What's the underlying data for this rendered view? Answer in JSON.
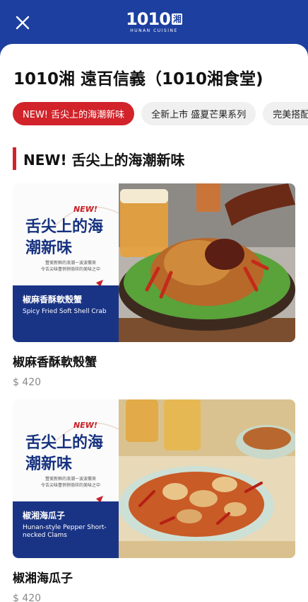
{
  "header": {
    "logo_text": "1010",
    "logo_box_text": "湘",
    "logo_subtext": "HUNAN CUISINE"
  },
  "store": {
    "title": "1010湘 遠百信義（1010湘食堂)"
  },
  "tabs": [
    {
      "label": "NEW! 舌尖上的海潮新味",
      "active": true
    },
    {
      "label": "全新上市 盛夏芒果系列",
      "active": false
    },
    {
      "label": "完美搭配",
      "active": false
    }
  ],
  "section": {
    "title": "NEW! 舌尖上的海潮新味"
  },
  "items": [
    {
      "promo_new": "NEW!",
      "promo_title": "舌尖上的海潮新味",
      "promo_lines": [
        "豐美新鮮的浪潮一波波襲來",
        "令舌尖味蕾悄悄徜徉的美味之中"
      ],
      "band_zh": "椒麻香酥軟殼蟹",
      "band_en": "Spicy Fried Soft Shell Crab",
      "name": "椒麻香酥軟殼蟹",
      "price": "$ 420"
    },
    {
      "promo_new": "NEW!",
      "promo_title": "舌尖上的海潮新味",
      "promo_lines": [
        "豐美新鮮的浪潮一波波襲來",
        "令舌尖味蕾悄悄徜徉的美味之中"
      ],
      "band_zh": "椒湘海瓜子",
      "band_en": "Hunan-style Pepper Short-necked Clams",
      "name": "椒湘海瓜子",
      "price": "$ 420"
    }
  ],
  "colors": {
    "brand_blue": "#1d3fa0",
    "accent_red": "#d2232a",
    "band_navy": "#1a3485"
  }
}
